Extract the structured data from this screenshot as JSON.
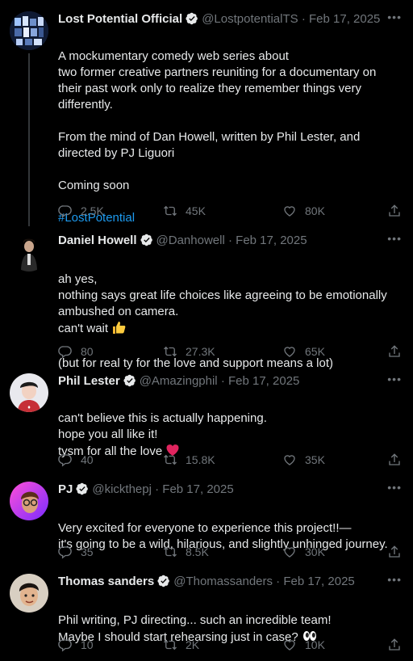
{
  "tweets": [
    {
      "name": "Lost Potential Official",
      "handle": "@LostpotentialTS",
      "dot": "·",
      "date": "Feb 17, 2025",
      "text": "A mockumentary comedy web series about\ntwo former creative partners reuniting for a documentary on\ntheir past work only to realize they remember things very\ndifferently.\n\nFrom the mind of Dan Howell, written by Phil Lester, and\ndirected by PJ Liguori\n\nComing soon",
      "hashtag": "#LostPotential",
      "replies": "2.5K",
      "retweets": "45K",
      "likes": "80K"
    },
    {
      "name": "Daniel Howell",
      "handle": "@Danhowell",
      "dot": "·",
      "date": "Feb 17, 2025",
      "text_a": "ah yes,\nnothing says great life choices like agreeing to be emotionally\nambushed on camera.\ncan't wait ",
      "text_b": "(but for real ty for the love and support means a lot)",
      "replies": "80",
      "retweets": "27.3K",
      "likes": "65K"
    },
    {
      "name": "Phil Lester",
      "handle": "@Amazingphil",
      "dot": "·",
      "date": "Feb 17, 2025",
      "text": "can't believe this is actually happening.\nhope you all like it!\ntysm for all the love ",
      "replies": "40",
      "retweets": "15.8K",
      "likes": "35K"
    },
    {
      "name": "PJ",
      "handle": "@kickthepj",
      "dot": "·",
      "date": "Feb 17, 2025",
      "text": "Very excited for everyone to experience this project!!—\nit's going to be a wild, hilarious, and slightly unhinged journey.",
      "replies": "35",
      "retweets": "8.5K",
      "likes": "30K"
    },
    {
      "name": "Thomas sanders",
      "handle": "@Thomassanders",
      "dot": "·",
      "date": "Feb 17, 2025",
      "text": "Phil writing, PJ directing... such an incredible team!\nMaybe I should start rehearsing just in case? ",
      "replies": "10",
      "retweets": "2K",
      "likes": "10K"
    }
  ],
  "colors": {
    "background": "#000000",
    "text": "#e7e9ea",
    "muted": "#71767b",
    "link": "#1d9bf0",
    "verified": "#e7e9ea"
  },
  "icons": [
    "verified-badge-icon",
    "more-icon",
    "reply-icon",
    "retweet-icon",
    "like-icon",
    "share-icon",
    "thumbs-up-emoji",
    "red-heart-emoji",
    "eyes-emoji"
  ]
}
